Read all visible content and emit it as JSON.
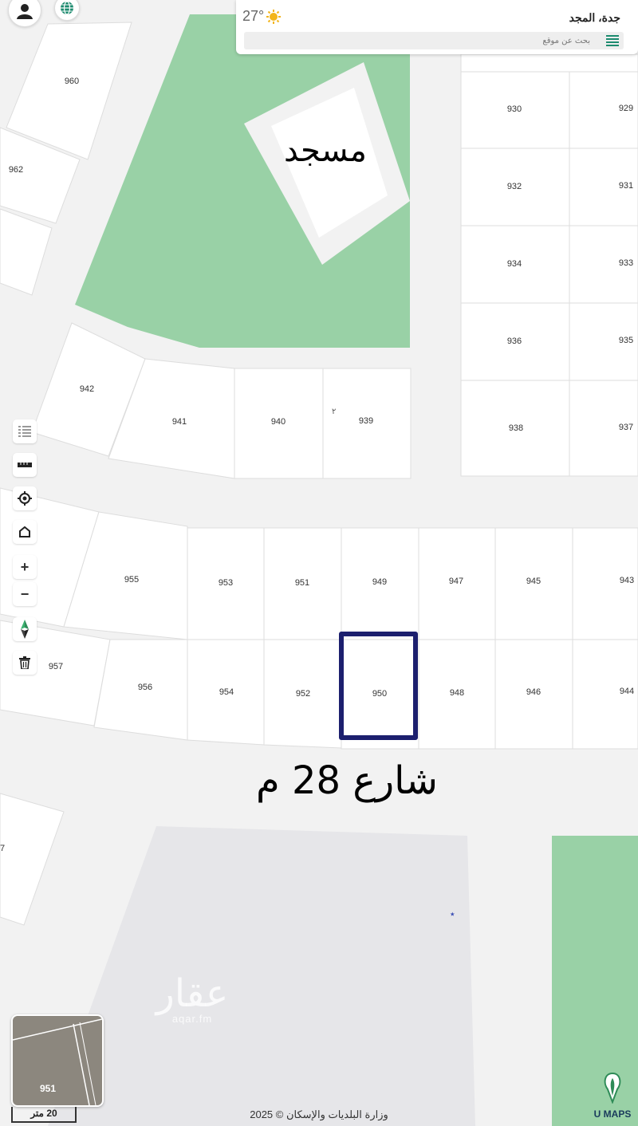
{
  "topbar": {
    "user_icon": "user-icon",
    "globe_icon": "globe-icon"
  },
  "search_panel": {
    "temperature": "27°",
    "weather_icon": "sun-icon",
    "location": "جدة، المجد",
    "search_placeholder": "بحث عن موقع",
    "menu_icon": "menu-icon"
  },
  "map": {
    "mosque_label": "مسجد",
    "street_label": "شارع 28 م",
    "plots": [
      "960",
      "962",
      "930",
      "929",
      "932",
      "931",
      "934",
      "933",
      "936",
      "935",
      "942",
      "941",
      "940",
      "939",
      "938",
      "937",
      "955",
      "953",
      "951",
      "949",
      "947",
      "945",
      "943",
      "957",
      "956",
      "954",
      "952",
      "950",
      "948",
      "946",
      "944",
      "7"
    ],
    "highlighted_plot": "950",
    "colors": {
      "park": "#99d1a6",
      "plot": "#ffffff",
      "road": "#f1f1f1",
      "gray_block": "#e6e6e9",
      "highlight": "#1c1f6e"
    }
  },
  "toolbar": {
    "list_icon": "list-icon",
    "ruler_icon": "ruler-icon",
    "locate_icon": "locate-icon",
    "home_icon": "home-icon",
    "zoom_in": "+",
    "zoom_out": "−",
    "compass_icon": "compass-icon",
    "trash_icon": "trash-icon"
  },
  "minimap": {
    "label": "951"
  },
  "footer": {
    "scale": "20 متر",
    "copyright": "وزارة البلديات والإسكان © 2025",
    "brand": "U MAPS"
  },
  "watermark": {
    "title": "عقار",
    "subtitle": "aqar.fm"
  }
}
